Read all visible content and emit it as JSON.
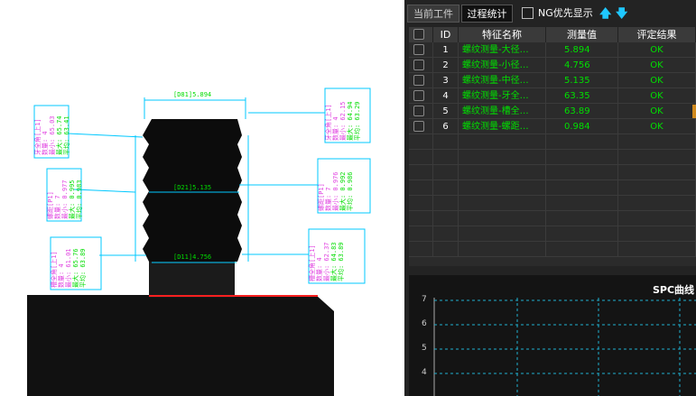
{
  "image_panel": {
    "dims": {
      "top": "[D81]5.894",
      "mid": "[D21]5.135",
      "bottom": "[D11]4.756"
    },
    "left_boxes": [
      {
        "title": "牙全角[上1]",
        "count": "数量: 4",
        "min": "最小: 65.03",
        "max": "最大: 65.74",
        "avg": "平均: 63.41"
      },
      {
        "title": "螺距[P1]",
        "count": "数量: 7",
        "min": "最小: 0.977",
        "max": "最大: 0.995",
        "avg": "平均: 0.983"
      },
      {
        "title": "槽全角[上1]",
        "count": "数量: 4",
        "min": "最小: 61.01",
        "max": "最大: 65.76",
        "avg": "平均: 63.89"
      }
    ],
    "right_boxes": [
      {
        "title": "牙全角[上1]",
        "count": "数量: 4",
        "min": "最小: 62.15",
        "max": "最大: 64.94",
        "avg": "平均: 63.29"
      },
      {
        "title": "螺距[P1]",
        "count": "数量: 7",
        "min": "最小: 0.976",
        "max": "最大: 0.992",
        "avg": "平均: 0.986"
      },
      {
        "title": "槽全角[上1]",
        "count": "数量: 4",
        "min": "最小: 62.37",
        "max": "最大: 64.83",
        "avg": "平均: 63.89"
      }
    ]
  },
  "tabs": [
    {
      "label": "当前工件",
      "active": false
    },
    {
      "label": "过程统计",
      "active": true
    }
  ],
  "ng_first": {
    "label": "NG优先显示",
    "checked": false
  },
  "table": {
    "headers": [
      "",
      "ID",
      "特征名称",
      "测量值",
      "评定结果"
    ],
    "rows": [
      {
        "id": "1",
        "name": "螺纹测量-大径…",
        "value": "5.894",
        "result": "OK",
        "highlight": false
      },
      {
        "id": "2",
        "name": "螺纹测量-小径…",
        "value": "4.756",
        "result": "OK",
        "highlight": false
      },
      {
        "id": "3",
        "name": "螺纹测量-中径…",
        "value": "5.135",
        "result": "OK",
        "highlight": false
      },
      {
        "id": "4",
        "name": "螺纹测量-牙全…",
        "value": "63.35",
        "result": "OK",
        "highlight": false
      },
      {
        "id": "5",
        "name": "螺纹测量-槽全…",
        "value": "63.89",
        "result": "OK",
        "highlight": true
      },
      {
        "id": "6",
        "name": "螺纹测量-螺距…",
        "value": "0.984",
        "result": "OK",
        "highlight": false
      }
    ]
  },
  "spc": {
    "title": "SPC曲线",
    "y_ticks": [
      "7",
      "6",
      "5",
      "4"
    ]
  },
  "colors": {
    "ok_green": "#00e000",
    "annotation_cyan": "#00c8ff",
    "annotation_green": "#00dd00",
    "annotation_magenta": "#e040e0",
    "arrow_blue": "#1fc7ff",
    "highlight_orange": "#d08a1e",
    "edge_red": "#ff2020"
  }
}
